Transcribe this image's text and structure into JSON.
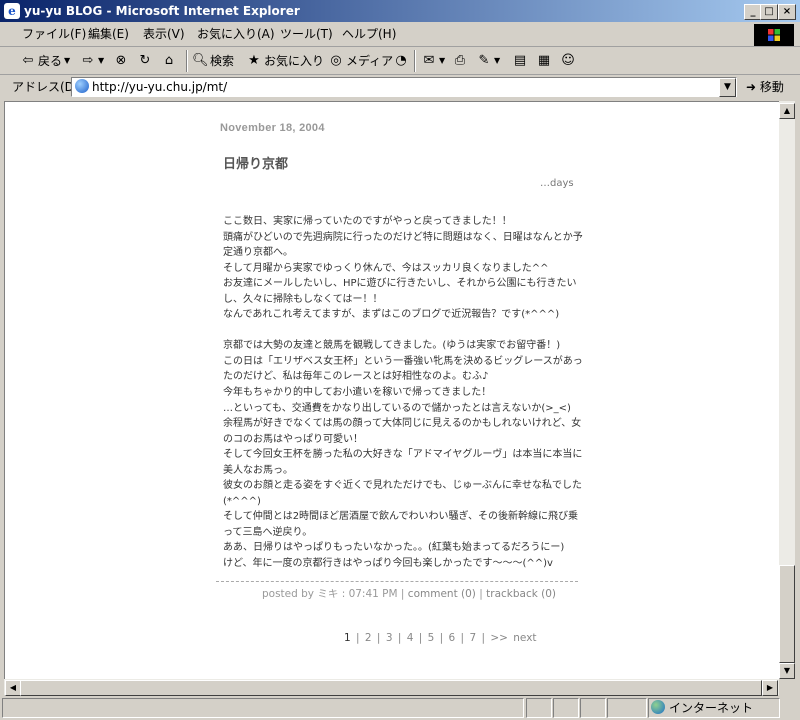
{
  "window": {
    "title": "yu-yu BLOG - Microsoft Internet Explorer",
    "minimize": "_",
    "maximize": "□",
    "close": "×"
  },
  "menu": {
    "file": "ファイル(F)",
    "edit": "編集(E)",
    "view": "表示(V)",
    "favorites": "お気に入り(A)",
    "tools": "ツール(T)",
    "help": "ヘルプ(H)"
  },
  "toolbar": {
    "back": "戻る",
    "search": "検索",
    "favorites": "お気に入り",
    "media": "メディア"
  },
  "address": {
    "label": "アドレス(D)",
    "url": "http://yu-yu.chu.jp/mt/",
    "go": "移動"
  },
  "post": {
    "date": "November 18, 2004",
    "title": "日帰り京都",
    "category": "…days",
    "body": "ここ数日、実家に帰っていたのですがやっと戻ってきました！！\n頭痛がひどいので先週病院に行ったのだけど特に問題はなく、日曜はなんとか予定通り京都へ。\nそして月曜から実家でゆっくり休んで、今はスッカリ良くなりました^^\nお友達にメールしたいし、HPに遊びに行きたいし、それから公園にも行きたいし、久々に掃除もしなくてはー！！\nなんであれこれ考えてますが、まずはこのブログで近況報告？です(*^^^)\n\n京都では大勢の友達と競馬を観戦してきました。(ゆうは実家でお留守番！)\nこの日は「エリザベス女王杯」という一番強い牝馬を決めるビッグレースがあったのだけど、私は毎年このレースとは好相性なのよ。むふ♪\n今年もちゃかり的中してお小遣いを稼いで帰ってきました！\n…といっても、交通費をかなり出しているので儲かったとは言えないか(>_<)\n余程馬が好きでなくては馬の顔って大体同じに見えるのかもしれないけれど、女のコのお馬はやっぱり可愛い！\nそして今回女王杯を勝った私の大好きな「アドマイヤグルーヴ」は本当に本当に美人なお馬っ。\n彼女のお顔と走る姿をすぐ近くで見れただけでも、じゅーぶんに幸せな私でした(*^^^)\nそして仲間とは2時間ほど居酒屋で飲んでわいわい騒ぎ、その後新幹線に飛び乗って三島へ逆戻り。\nああ、日帰りはやっぱりもったいなかった。。(紅葉も始まってるだろうにー)\nけど、年に一度の京都行きはやっぱり今回も楽しかったです〜〜〜(^^)v",
    "posted_by": "posted by ミキ : 07:41 PM",
    "sep": "|",
    "comment": "comment (0)",
    "trackback": "trackback (0)"
  },
  "pager": {
    "pages": [
      "1",
      "2",
      "3",
      "4",
      "5",
      "6",
      "7"
    ],
    "next": ">> next"
  },
  "status": {
    "zone": "インターネット"
  }
}
